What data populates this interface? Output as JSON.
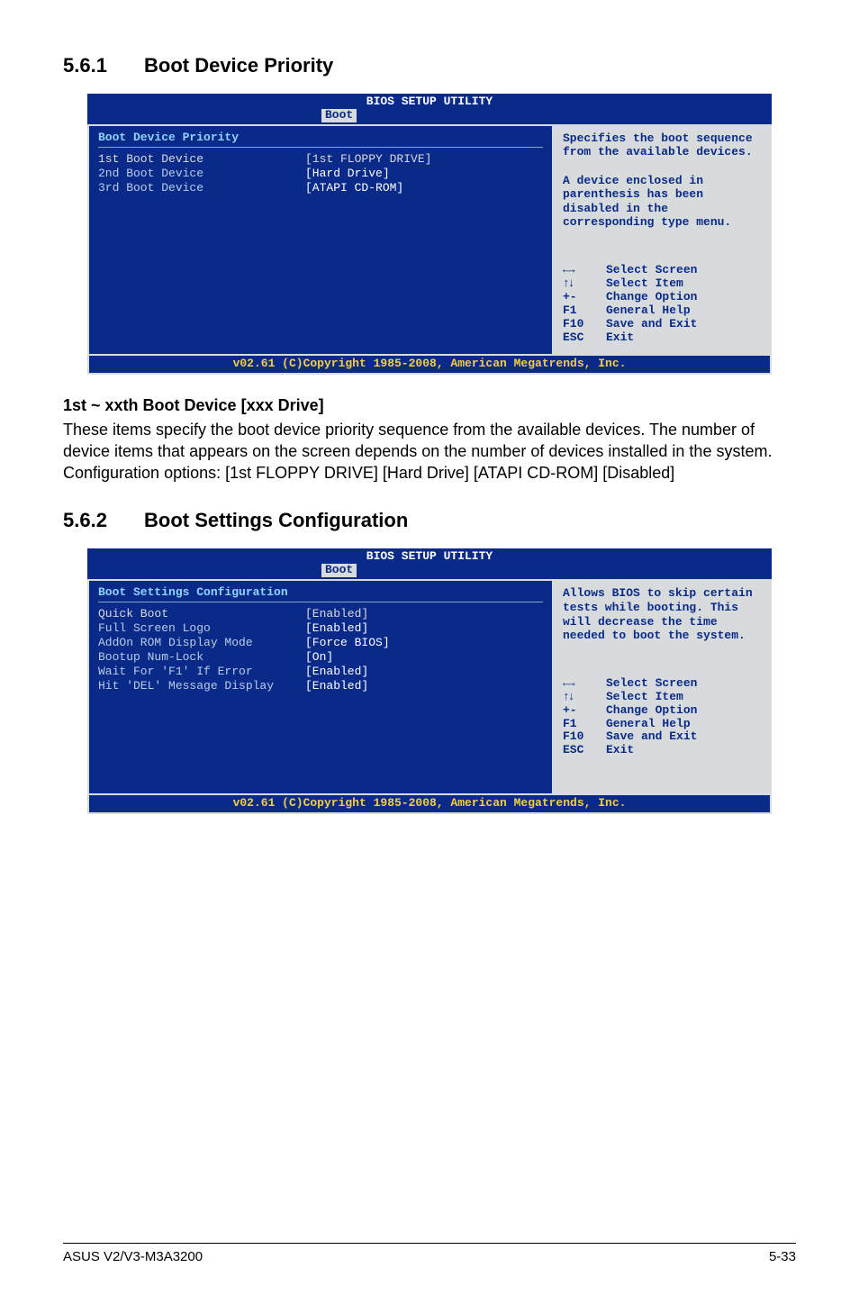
{
  "sections": {
    "s1": {
      "num": "5.6.1",
      "title": "Boot Device Priority"
    },
    "s2": {
      "num": "5.6.2",
      "title": "Boot Settings Configuration"
    }
  },
  "bios_common": {
    "header": "BIOS SETUP UTILITY",
    "tab": "Boot",
    "footer": "v02.61 (C)Copyright 1985-2008, American Megatrends, Inc.",
    "keys": {
      "lr": "Select Screen",
      "ud": "Select Item",
      "pm_k": "+-",
      "pm_v": "Change Option",
      "f1_k": "F1",
      "f1_v": "General Help",
      "f10_k": "F10",
      "f10_v": "Save and Exit",
      "esc_k": "ESC",
      "esc_v": "Exit"
    }
  },
  "bios1": {
    "panel_title": "Boot Device Priority",
    "rows": [
      {
        "label": "1st Boot Device",
        "val": "[1st FLOPPY DRIVE]"
      },
      {
        "label": "2nd Boot Device",
        "val": "[Hard Drive]"
      },
      {
        "label": "3rd Boot Device",
        "val": "[ATAPI CD-ROM]"
      }
    ],
    "help": "Specifies the boot sequence from the available devices.\n\nA device enclosed in parenthesis has been disabled in the corresponding type menu."
  },
  "bios2": {
    "panel_title": "Boot Settings Configuration",
    "rows": [
      {
        "label": "Quick Boot",
        "val": "[Enabled]"
      },
      {
        "label": "Full Screen Logo",
        "val": "[Enabled]"
      },
      {
        "label": "AddOn ROM Display Mode",
        "val": "[Force BIOS]"
      },
      {
        "label": "Bootup Num-Lock",
        "val": "[On]"
      },
      {
        "label": "Wait For 'F1' If Error",
        "val": "[Enabled]"
      },
      {
        "label": "Hit 'DEL' Message Display",
        "val": "[Enabled]"
      }
    ],
    "help": "Allows BIOS to skip certain tests while booting. This will decrease the time needed to boot the system."
  },
  "text": {
    "sub1_title": "1st ~ xxth Boot Device [xxx Drive]",
    "sub1_para": "These items specify the boot device priority sequence from the available devices. The number of device items that appears on the screen depends on the number of devices installed in the system.\nConfiguration options: [1st FLOPPY DRIVE] [Hard Drive] [ATAPI CD-ROM] [Disabled]"
  },
  "footer": {
    "left": "ASUS V2/V3-M3A3200",
    "right": "5-33"
  }
}
